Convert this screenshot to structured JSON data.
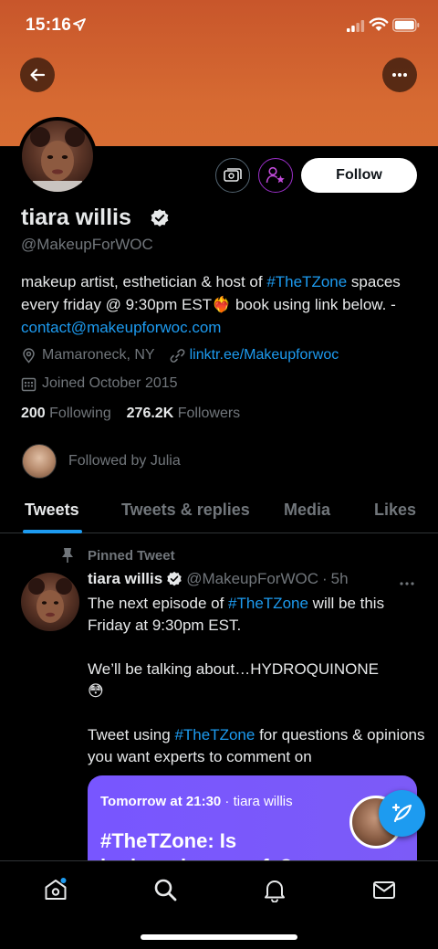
{
  "status_bar": {
    "time": "15:16"
  },
  "profile": {
    "name": "tiara willis",
    "handle": "@MakeupForWOC",
    "follow_label": "Follow",
    "bio_part1": "makeup artist, esthetician & host of ",
    "bio_hashtag": "#TheTZone",
    "bio_part2": " spaces every friday @ 9:30pm EST",
    "bio_emoji": "❤️‍🔥",
    "bio_part3": " book using link below. - ",
    "bio_email": "contact@makeupforwoc.com",
    "location": "Mamaroneck, NY",
    "website": "linktr.ee/Makeupforwoc",
    "joined": "Joined October 2015",
    "following_count": "200",
    "following_label": "Following",
    "followers_count": "276.2K",
    "followers_label": "Followers",
    "followed_by": "Followed by Julia"
  },
  "tabs": [
    {
      "label": "Tweets"
    },
    {
      "label": "Tweets & replies"
    },
    {
      "label": "Media"
    },
    {
      "label": "Likes"
    }
  ],
  "pinned_tweet": {
    "pinned_label": "Pinned Tweet",
    "name": "tiara willis",
    "handle": "@MakeupForWOC",
    "time": "5h",
    "line1_a": "The next episode of ",
    "line1_hashtag": "#TheTZone",
    "line1_b": " will be this Friday at 9:30pm EST.",
    "line2": "We’ll be talking about…HYDROQUINONE",
    "line2_emoji": "😳",
    "line3_a": "Tweet using ",
    "line3_hashtag": "#TheTZone",
    "line3_b": " for questions & opinions you want experts to comment on",
    "space_when": "Tomorrow at 21:30",
    "space_host": "tiara willis",
    "space_title": "#TheTZone: Is hydroquinone safe?"
  },
  "colors": {
    "accent": "#1d9bf0",
    "banner": "#d0602f",
    "space_card": "#7856ff"
  }
}
